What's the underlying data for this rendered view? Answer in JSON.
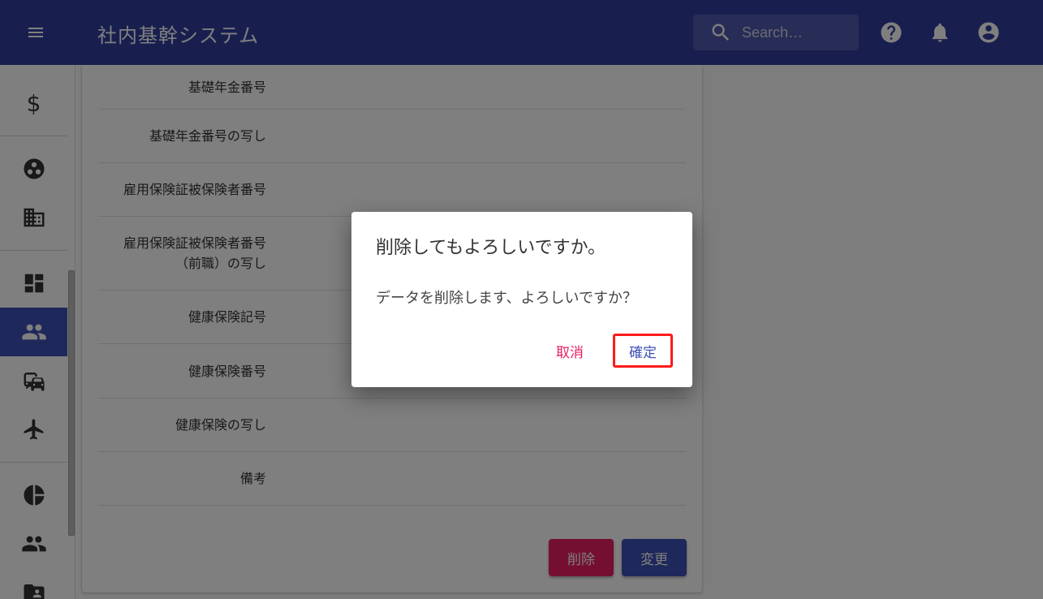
{
  "app": {
    "title": "社内基幹システム"
  },
  "search": {
    "placeholder": "Search…"
  },
  "appbar_icons": [
    "menu-icon",
    "search-icon",
    "help-icon",
    "bell-icon",
    "account-icon"
  ],
  "sidebar": {
    "items": [
      {
        "icon": "dollar-icon",
        "glyph": "$"
      },
      {
        "icon": "group-circle-icon"
      },
      {
        "icon": "building-icon"
      },
      {
        "icon": "dashboard-icon"
      },
      {
        "icon": "people-icon",
        "active": true
      },
      {
        "icon": "commute-icon"
      },
      {
        "icon": "flight-icon"
      },
      {
        "icon": "pie-chart-icon"
      },
      {
        "icon": "people-icon"
      },
      {
        "icon": "folder-shared-icon"
      }
    ],
    "active_color": "#3f51b5"
  },
  "form": {
    "rows": [
      {
        "label": "基礎年金番号"
      },
      {
        "label": "基礎年金番号の写し"
      },
      {
        "label": "雇用保険証被保険者番号"
      },
      {
        "label": "雇用保険証被保険者番号",
        "label_line2": "（前職）の写し"
      },
      {
        "label": "健康保険記号"
      },
      {
        "label": "健康保険番号"
      },
      {
        "label": "健康保険の写し"
      },
      {
        "label": "備考"
      }
    ],
    "delete_label": "削除",
    "change_label": "変更"
  },
  "dialog": {
    "title": "削除してもよろしいですか。",
    "message": "データを削除します、よろしいですか？",
    "cancel_label": "取消",
    "confirm_label": "確定"
  },
  "colors": {
    "primary": "#3f51b5",
    "appbar": "#303f9f",
    "accent": "#e91e63",
    "highlight": "#ff1a1a"
  }
}
